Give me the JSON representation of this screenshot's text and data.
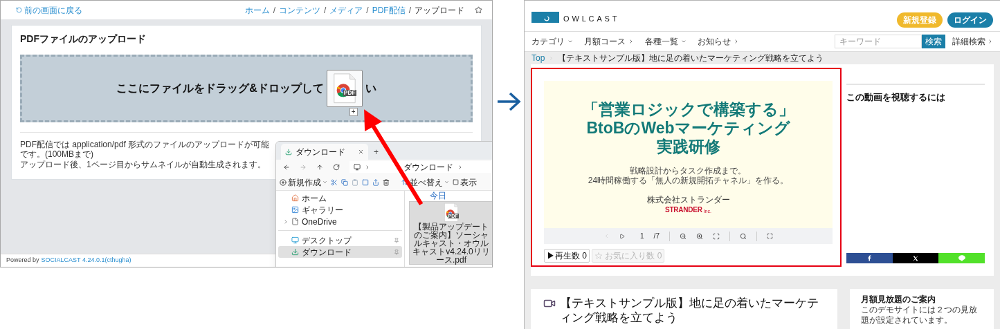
{
  "left_screen": {
    "back_link": "前の画面に戻る",
    "breadcrumb_separator": "/",
    "breadcrumb": [
      {
        "label": "ホーム",
        "current": false
      },
      {
        "label": "コンテンツ",
        "current": false
      },
      {
        "label": "メディア",
        "current": false
      },
      {
        "label": "PDF配信",
        "current": false
      },
      {
        "label": "アップロード",
        "current": true
      }
    ],
    "page_title": "PDFファイルのアップロード",
    "dropzone": {
      "text_before": "ここにファイルをドラッグ&ドロップして",
      "text_after": "い",
      "icon_label": "PDF",
      "drag_badge": "+"
    },
    "description": [
      "PDF配信では application/pdf 形式のファイルのアップロードが可能です。(100MBまで)",
      "アップロード後、1ページ目からサムネイルが自動生成されます。"
    ],
    "footer": {
      "prefix": "Powered by",
      "link": "SOCIALCAST 4.24.0.1(cthugha)"
    },
    "explorer": {
      "tab_title": "ダウンロード",
      "new_tab": "+",
      "address": "ダウンロード",
      "new_button": "新規作成",
      "sort_button": "並べ替え",
      "view_button": "表示",
      "nav_groups": [
        [
          {
            "kind": "home",
            "label": "ホーム",
            "selected": false,
            "pinned": false,
            "expandable": false
          },
          {
            "kind": "gallery",
            "label": "ギャラリー",
            "selected": false,
            "pinned": false,
            "expandable": false
          },
          {
            "kind": "cloud",
            "label": "OneDrive",
            "selected": false,
            "pinned": false,
            "expandable": true
          }
        ],
        [
          {
            "kind": "desktop",
            "label": "デスクトップ",
            "selected": false,
            "pinned": true,
            "expandable": false
          },
          {
            "kind": "downloads",
            "label": "ダウンロード",
            "selected": true,
            "pinned": true,
            "expandable": false
          }
        ]
      ],
      "group_header": "今日",
      "file": {
        "name": "【製品アップデートのご案内】ソーシャルキャスト・オウルキャストv4.24.0リリース.pdf",
        "icon_label": "PDF",
        "selected": true
      }
    }
  },
  "right_screen": {
    "logo_text": "OWLCAST",
    "header_buttons": [
      {
        "kind": "register",
        "label": "新規登録"
      },
      {
        "kind": "login",
        "label": "ログイン"
      }
    ],
    "nav": [
      {
        "kind": "dropdown",
        "label": "カテゴリ"
      },
      {
        "kind": "link",
        "label": "月額コース"
      },
      {
        "kind": "dropdown",
        "label": "各種一覧"
      },
      {
        "kind": "link",
        "label": "お知らせ"
      }
    ],
    "search": {
      "placeholder": "キーワード",
      "button": "検索"
    },
    "advanced_search": "詳細検索",
    "breadcrumb": [
      {
        "kind": "link",
        "label": "Top"
      },
      {
        "kind": "current",
        "label": "【テキストサンプル版】地に足の着いたマーケティング戦略を立てよう"
      }
    ],
    "slide": {
      "title_lines": [
        "「営業ロジックで構築する」",
        "BtoBのWebマーケティング",
        "実践研修"
      ],
      "subtitle_lines": [
        "戦略設計からタスク作成まで。",
        "24時間稼働する「無人の新規開拓チャネル」を作る。"
      ],
      "company": "株式会社ストランダー",
      "brand": "STRANDER",
      "brand_suffix": "Inc."
    },
    "viewer": {
      "page": "1",
      "total": "/7"
    },
    "stats": [
      {
        "label": "▶再生数 0",
        "disabled": false
      },
      {
        "label": "☆ お気に入り数 0",
        "disabled": true
      }
    ],
    "sidebar_title": "この動画を視聴するには",
    "share": [
      {
        "kind": "facebook",
        "color": "#2d4f94"
      },
      {
        "kind": "x",
        "color": "#000000"
      },
      {
        "kind": "line",
        "color": "#52e12a"
      }
    ],
    "article_title": "【テキストサンプル版】地に足の着いたマーケティング戦略を立てよう",
    "side_info": {
      "title": "月額見放題のご案内",
      "text": "このデモサイトには２つの見放題が設定されています。"
    }
  }
}
